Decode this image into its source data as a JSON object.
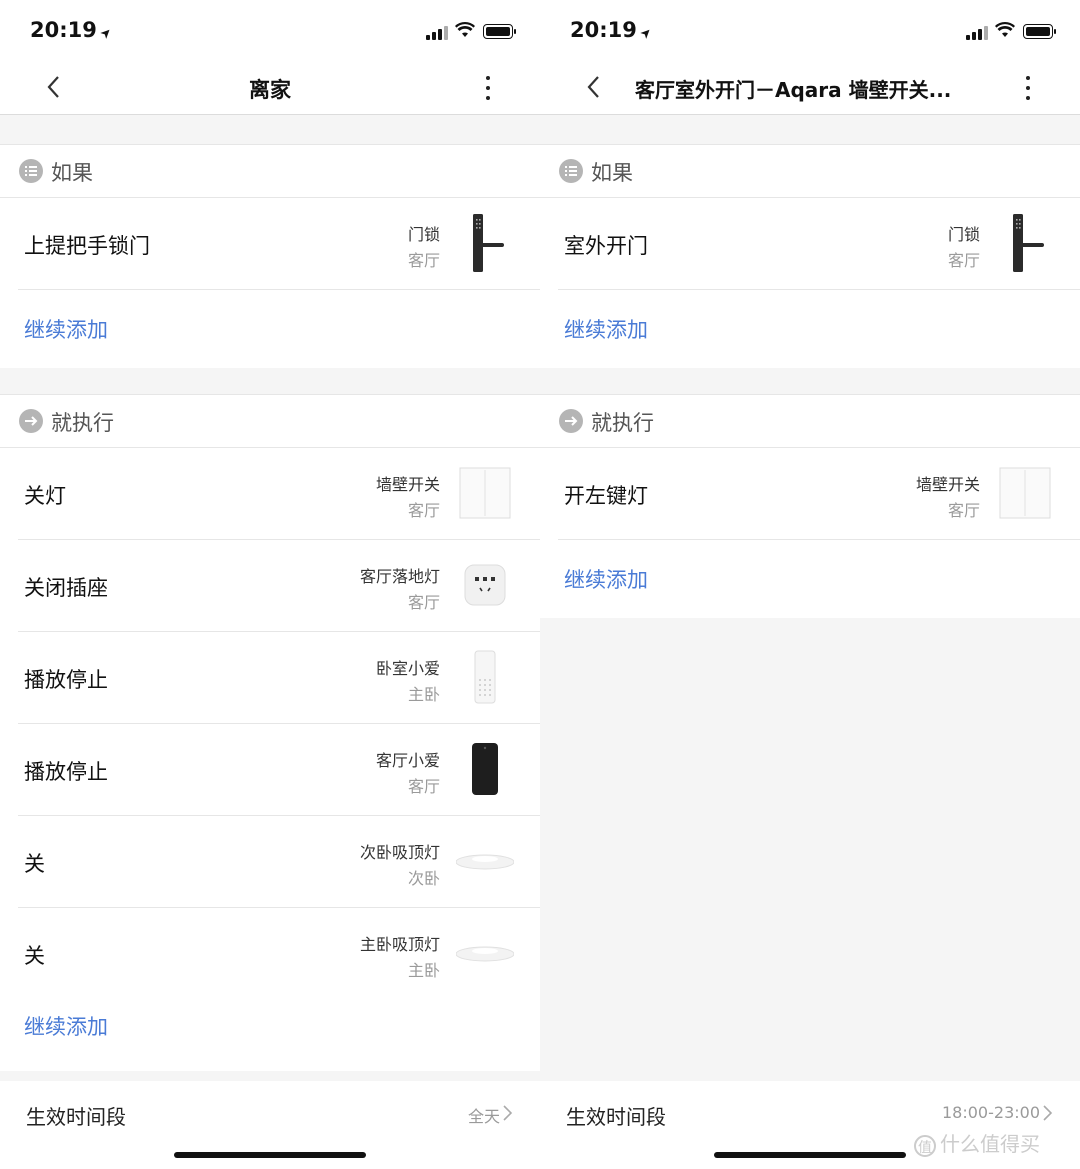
{
  "left": {
    "status": {
      "time": "20:19"
    },
    "nav": {
      "title": "离家"
    },
    "if_section": {
      "title": "如果",
      "rows": [
        {
          "action": "上提把手锁门",
          "device": "门锁",
          "room": "客厅",
          "icon": "door-lock-icon"
        }
      ],
      "add": "继续添加"
    },
    "then_section": {
      "title": "就执行",
      "rows": [
        {
          "action": "关灯",
          "device": "墙壁开关",
          "room": "客厅",
          "icon": "wall-switch-icon"
        },
        {
          "action": "关闭插座",
          "device": "客厅落地灯",
          "room": "客厅",
          "icon": "smart-plug-icon"
        },
        {
          "action": "播放停止",
          "device": "卧室小爱",
          "room": "主卧",
          "icon": "white-speaker-icon"
        },
        {
          "action": "播放停止",
          "device": "客厅小爱",
          "room": "客厅",
          "icon": "black-speaker-icon"
        },
        {
          "action": "关",
          "device": "次卧吸顶灯",
          "room": "次卧",
          "icon": "ceiling-light-icon"
        },
        {
          "action": "关",
          "device": "主卧吸顶灯",
          "room": "主卧",
          "icon": "ceiling-light-icon"
        }
      ],
      "add": "继续添加"
    },
    "footer": {
      "label": "生效时间段",
      "value": "全天"
    }
  },
  "right": {
    "status": {
      "time": "20:19"
    },
    "nav": {
      "title": "客厅室外开门－Aqara 墙壁开关..."
    },
    "if_section": {
      "title": "如果",
      "rows": [
        {
          "action": "室外开门",
          "device": "门锁",
          "room": "客厅",
          "icon": "door-lock-icon"
        }
      ],
      "add": "继续添加"
    },
    "then_section": {
      "title": "就执行",
      "rows": [
        {
          "action": "开左键灯",
          "device": "墙壁开关",
          "room": "客厅",
          "icon": "wall-switch-icon"
        }
      ],
      "add": "继续添加"
    },
    "footer": {
      "label": "生效时间段",
      "value": "18:00-23:00"
    }
  },
  "watermark": {
    "text": "什么值得买",
    "icon": "值"
  },
  "colors": {
    "link": "#4a7bd6",
    "secondary": "#9a9a9a",
    "divider": "#e6e6e6"
  }
}
